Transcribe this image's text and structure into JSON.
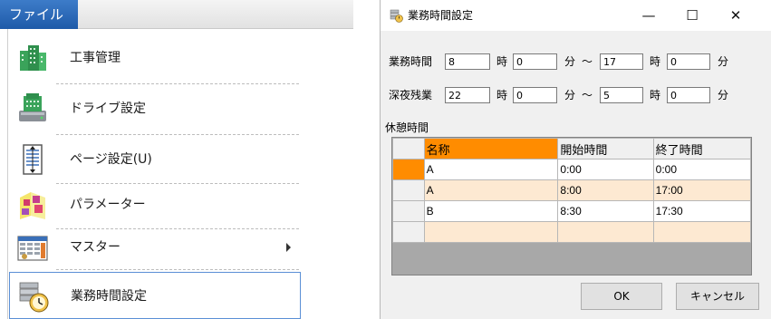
{
  "menu": {
    "tab_label": "ファイル",
    "items": [
      {
        "label": "工事管理",
        "icon": "building-icon"
      },
      {
        "label": "ドライブ設定",
        "icon": "drive-icon"
      },
      {
        "label": "ページ設定(U)",
        "icon": "page-setup-icon"
      },
      {
        "label": "パラメーター",
        "icon": "parameter-icon"
      },
      {
        "label": "マスター",
        "icon": "master-icon"
      },
      {
        "label": "業務時間設定",
        "icon": "business-hours-icon"
      }
    ]
  },
  "dialog": {
    "title": "業務時間設定",
    "controls": {
      "minimize": "—",
      "maximize": "☐",
      "close": "✕"
    },
    "work_hours": {
      "label": "業務時間",
      "start_hour": "8",
      "start_minute": "0",
      "end_hour": "17",
      "end_minute": "0"
    },
    "late_overtime": {
      "label": "深夜残業",
      "start_hour": "22",
      "start_minute": "0",
      "end_hour": "5",
      "end_minute": "0"
    },
    "units": {
      "hour": "時",
      "minute": "分",
      "range": "～"
    },
    "break_label": "休憩時間",
    "grid": {
      "columns": [
        "名称",
        "開始時間",
        "終了時間"
      ],
      "rows": [
        {
          "name": "A",
          "start": "0:00",
          "end": "0:00"
        },
        {
          "name": "A",
          "start": "8:00",
          "end": "17:00"
        },
        {
          "name": "B",
          "start": "8:30",
          "end": "17:30"
        },
        {
          "name": "",
          "start": "",
          "end": ""
        }
      ]
    },
    "ok_label": "OK",
    "cancel_label": "キャンセル"
  },
  "colors": {
    "accent": "#ff8c00",
    "row_alt": "#fde9d2",
    "menu_tab": "#1e5aa8"
  }
}
